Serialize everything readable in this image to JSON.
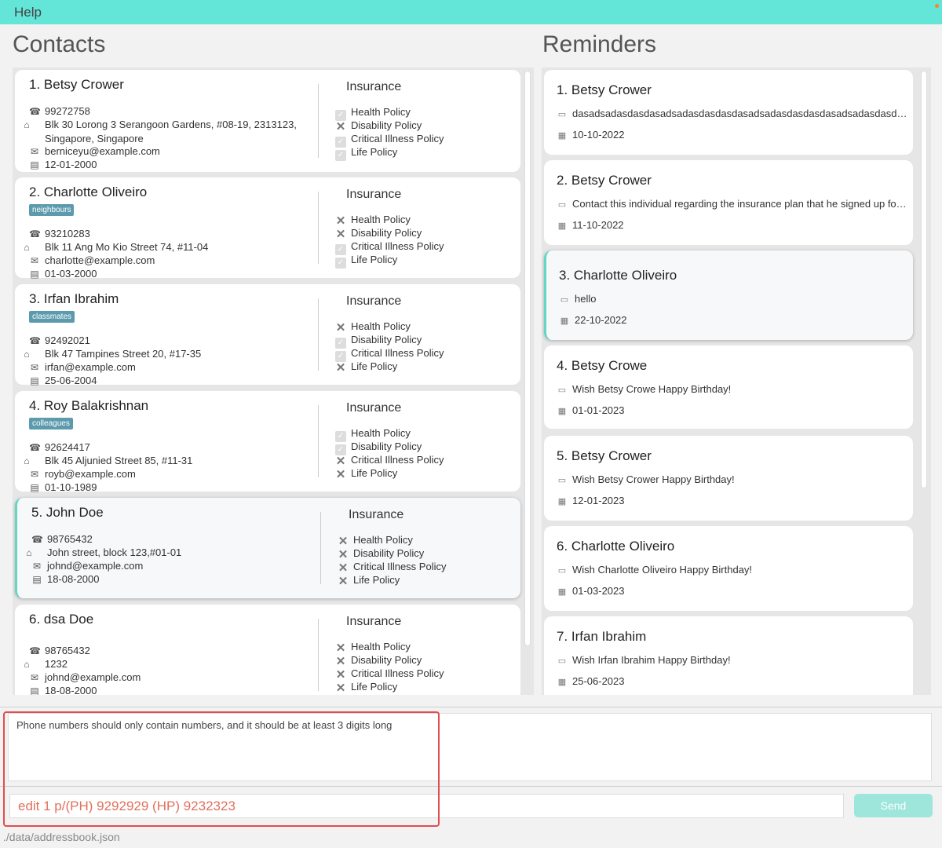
{
  "menubar": {
    "help": "Help"
  },
  "contacts": {
    "title": "Contacts",
    "items": [
      {
        "name": "1.  Betsy Crower",
        "tag": "",
        "phone": "99272758",
        "address": "Blk 30 Lorong 3 Serangoon Gardens, #08-19, 2313123, Singapore, Singapore",
        "email": "berniceyu@example.com",
        "birthday": "12-01-2000",
        "insurance_title": "Insurance",
        "policies": [
          {
            "label": "Health Policy",
            "state": "check"
          },
          {
            "label": "Disability Policy",
            "state": "cross"
          },
          {
            "label": "Critical Illness Policy",
            "state": "check"
          },
          {
            "label": "Life Policy",
            "state": "check"
          }
        ]
      },
      {
        "name": "2.  Charlotte Oliveiro",
        "tag": "neighbours",
        "phone": "93210283",
        "address": "Blk 11 Ang Mo Kio Street 74, #11-04",
        "email": "charlotte@example.com",
        "birthday": "01-03-2000",
        "insurance_title": "Insurance",
        "policies": [
          {
            "label": "Health Policy",
            "state": "cross"
          },
          {
            "label": "Disability Policy",
            "state": "cross"
          },
          {
            "label": "Critical Illness Policy",
            "state": "check"
          },
          {
            "label": "Life Policy",
            "state": "check"
          }
        ]
      },
      {
        "name": "3.  Irfan Ibrahim",
        "tag": "classmates",
        "phone": "92492021",
        "address": "Blk 47 Tampines Street 20, #17-35",
        "email": "irfan@example.com",
        "birthday": "25-06-2004",
        "insurance_title": "Insurance",
        "policies": [
          {
            "label": "Health Policy",
            "state": "cross"
          },
          {
            "label": "Disability Policy",
            "state": "check"
          },
          {
            "label": "Critical Illness Policy",
            "state": "check"
          },
          {
            "label": "Life Policy",
            "state": "cross"
          }
        ]
      },
      {
        "name": "4.  Roy Balakrishnan",
        "tag": "colleagues",
        "phone": "92624417",
        "address": "Blk 45 Aljunied Street 85, #11-31",
        "email": "royb@example.com",
        "birthday": "01-10-1989",
        "insurance_title": "Insurance",
        "policies": [
          {
            "label": "Health Policy",
            "state": "check"
          },
          {
            "label": "Disability Policy",
            "state": "check"
          },
          {
            "label": "Critical Illness Policy",
            "state": "cross"
          },
          {
            "label": "Life Policy",
            "state": "cross"
          }
        ]
      },
      {
        "name": "5.  John Doe",
        "tag": "",
        "phone": "98765432",
        "address": "John street, block 123,#01-01",
        "email": "johnd@example.com",
        "birthday": "18-08-2000",
        "insurance_title": "Insurance",
        "policies": [
          {
            "label": "Health Policy",
            "state": "cross"
          },
          {
            "label": "Disability Policy",
            "state": "cross"
          },
          {
            "label": "Critical Illness Policy",
            "state": "cross"
          },
          {
            "label": "Life Policy",
            "state": "cross"
          }
        ]
      },
      {
        "name": "6.  dsa Doe",
        "tag": "",
        "phone": "98765432",
        "address": "1232",
        "email": "johnd@example.com",
        "birthday": "18-08-2000",
        "insurance_title": "Insurance",
        "policies": [
          {
            "label": "Health Policy",
            "state": "cross"
          },
          {
            "label": "Disability Policy",
            "state": "cross"
          },
          {
            "label": "Critical Illness Policy",
            "state": "cross"
          },
          {
            "label": "Life Policy",
            "state": "cross"
          }
        ]
      }
    ]
  },
  "reminders": {
    "title": "Reminders",
    "items": [
      {
        "name": "1.  Betsy Crower",
        "description": "dasadsadasdasdasadsadasdasdasdasadsadasdasdasdasadsadasdasdasdasadsadasdasdasdasadsad",
        "date": "10-10-2022"
      },
      {
        "name": "2.  Betsy Crower",
        "description": "Contact this individual regarding the insurance plan that he signed up for on the",
        "date": "11-10-2022"
      },
      {
        "name": "3.  Charlotte Oliveiro",
        "description": "hello",
        "date": "22-10-2022"
      },
      {
        "name": "4.  Betsy Crowe",
        "description": "Wish Betsy Crowe Happy Birthday!",
        "date": "01-01-2023"
      },
      {
        "name": "5.  Betsy Crower",
        "description": "Wish Betsy Crower Happy Birthday!",
        "date": "12-01-2023"
      },
      {
        "name": "6.  Charlotte Oliveiro",
        "description": "Wish Charlotte Oliveiro Happy Birthday!",
        "date": "01-03-2023"
      },
      {
        "name": "7.  Irfan Ibrahim",
        "description": "Wish Irfan Ibrahim Happy Birthday!",
        "date": "25-06-2023"
      }
    ]
  },
  "result": {
    "text": "Phone numbers should only contain numbers, and it should be at least 3 digits long"
  },
  "command": {
    "value": "edit 1 p/(PH) 9292929 (HP) 9232323"
  },
  "send": {
    "label": "Send"
  },
  "status": {
    "path": "./data/addressbook.json"
  },
  "colors": {
    "accent": "#63e5d8",
    "tag": "#5c9bad",
    "highlight": "#e24d4d",
    "command_text": "#e0705b"
  }
}
